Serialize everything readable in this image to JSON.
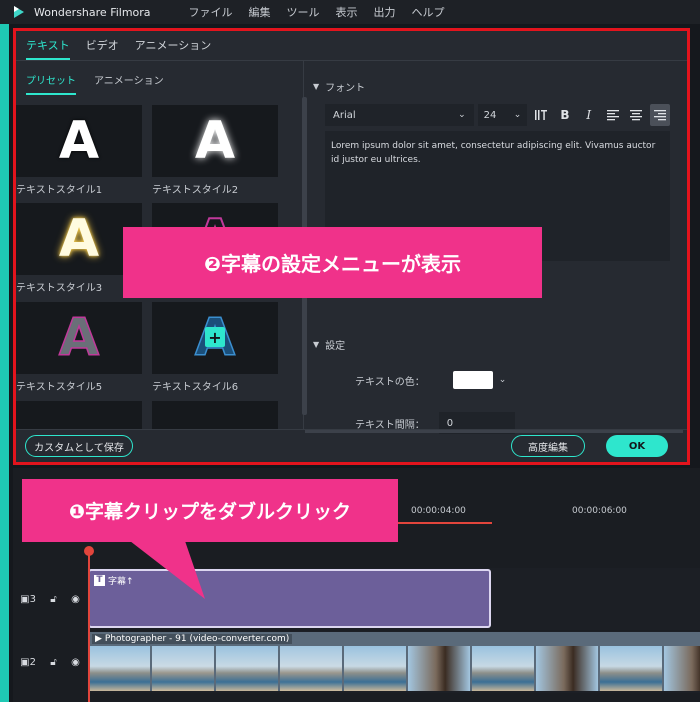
{
  "app": {
    "title": "Wondershare Filmora"
  },
  "menu": [
    "ファイル",
    "編集",
    "ツール",
    "表示",
    "出力",
    "ヘルプ"
  ],
  "editor": {
    "main_tabs": [
      "テキスト",
      "ビデオ",
      "アニメーション"
    ],
    "sub_tabs": [
      "プリセット",
      "アニメーション"
    ],
    "presets": [
      "テキストスタイル1",
      "テキストスタイル2",
      "テキストスタイル3",
      "",
      "テキストスタイル5",
      "テキストスタイル6"
    ],
    "font_section": "フォント",
    "font_name": "Arial",
    "font_size": "24",
    "text_content": "Lorem ipsum dolor sit amet, consectetur adipiscing elit. Vivamus auctor id justor eu ultrices.",
    "settings_section": "設定",
    "text_color_label": "テキストの色：",
    "text_spacing_label": "テキスト間隔：",
    "text_spacing_value": "0",
    "save_custom_label": "カスタムとして保存",
    "advanced_label": "高度編集",
    "ok_label": "OK",
    "colors": {
      "accent": "#2ee6cd",
      "highlight_border": "#e3141d"
    }
  },
  "callouts": {
    "step2": "❷字幕の設定メニューが表示",
    "step1": "❶字幕クリップをダブルクリック",
    "color": "#f0328a"
  },
  "timeline": {
    "ruler_ticks": [
      "00:00:04:00",
      "00:00:06:00"
    ],
    "tracks": [
      {
        "number": "3",
        "clip_label": "字幕↑"
      },
      {
        "number": "2",
        "clip_label": "Photographer - 91 (video-converter.com)"
      }
    ]
  }
}
